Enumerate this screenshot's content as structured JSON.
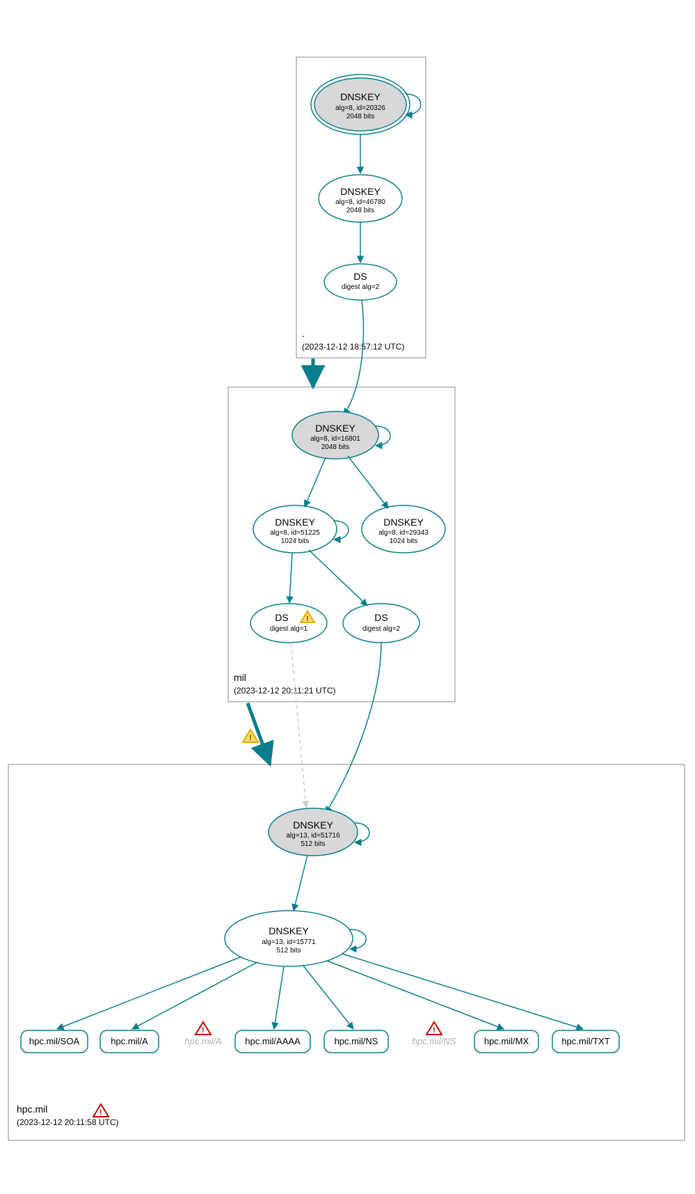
{
  "zones": {
    "root": {
      "label": ".",
      "timestamp": "(2023-12-12 18:57:12 UTC)"
    },
    "mil": {
      "label": "mil",
      "timestamp": "(2023-12-12 20:11:21 UTC)"
    },
    "hpc": {
      "label": "hpc.mil",
      "timestamp": "(2023-12-12 20:11:58 UTC)"
    }
  },
  "nodes": {
    "root_ksk": {
      "title": "DNSKEY",
      "sub1": "alg=8, id=20326",
      "sub2": "2048 bits"
    },
    "root_zsk": {
      "title": "DNSKEY",
      "sub1": "alg=8, id=46780",
      "sub2": "2048 bits"
    },
    "root_ds": {
      "title": "DS",
      "sub1": "digest alg=2"
    },
    "mil_ksk": {
      "title": "DNSKEY",
      "sub1": "alg=8, id=16801",
      "sub2": "2048 bits"
    },
    "mil_zsk1": {
      "title": "DNSKEY",
      "sub1": "alg=8, id=51225",
      "sub2": "1024 bits"
    },
    "mil_zsk2": {
      "title": "DNSKEY",
      "sub1": "alg=8, id=29343",
      "sub2": "1024 bits"
    },
    "mil_ds1": {
      "title": "DS",
      "sub1": "digest alg=1"
    },
    "mil_ds2": {
      "title": "DS",
      "sub1": "digest alg=2"
    },
    "hpc_ksk": {
      "title": "DNSKEY",
      "sub1": "alg=13, id=51716",
      "sub2": "512 bits"
    },
    "hpc_zsk": {
      "title": "DNSKEY",
      "sub1": "alg=13, id=15771",
      "sub2": "512 bits"
    }
  },
  "rr": {
    "soa": "hpc.mil/SOA",
    "a": "hpc.mil/A",
    "a2": "hpc.mil/A",
    "aaaa": "hpc.mil/AAAA",
    "ns": "hpc.mil/NS",
    "ns2": "hpc.mil/NS",
    "mx": "hpc.mil/MX",
    "txt": "hpc.mil/TXT"
  }
}
